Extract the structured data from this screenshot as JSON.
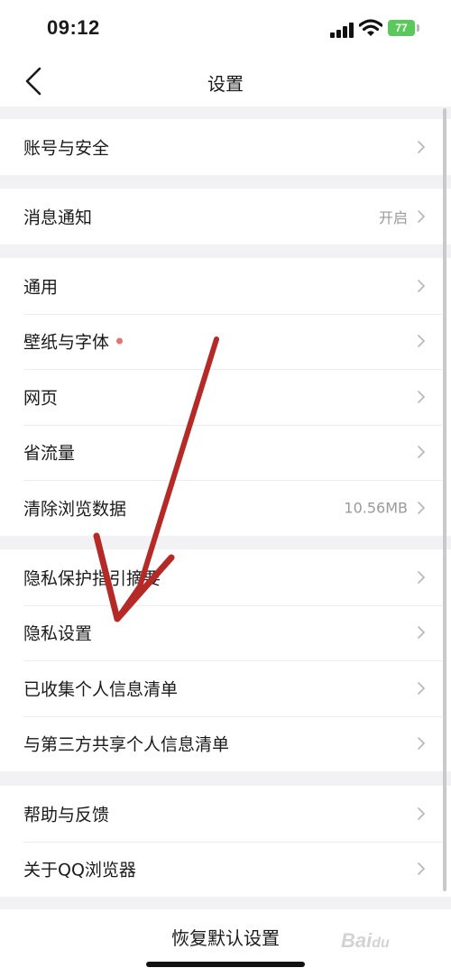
{
  "status_bar": {
    "time": "09:12",
    "battery": "77"
  },
  "header": {
    "title": "设置"
  },
  "groups": [
    {
      "items": [
        {
          "label": "账号与安全",
          "value": ""
        }
      ]
    },
    {
      "items": [
        {
          "label": "消息通知",
          "value": "开启"
        }
      ]
    },
    {
      "items": [
        {
          "label": "通用",
          "value": ""
        },
        {
          "label": "壁纸与字体",
          "value": "",
          "badge": true
        },
        {
          "label": "网页",
          "value": ""
        },
        {
          "label": "省流量",
          "value": ""
        },
        {
          "label": "清除浏览数据",
          "value": "10.56MB"
        }
      ]
    },
    {
      "items": [
        {
          "label": "隐私保护指引摘要",
          "value": ""
        },
        {
          "label": "隐私设置",
          "value": ""
        },
        {
          "label": "已收集个人信息清单",
          "value": ""
        },
        {
          "label": "与第三方共享个人信息清单",
          "value": ""
        }
      ]
    },
    {
      "items": [
        {
          "label": "帮助与反馈",
          "value": ""
        },
        {
          "label": "关于QQ浏览器",
          "value": ""
        }
      ]
    }
  ],
  "footer": {
    "reset_label": "恢复默认设置"
  },
  "watermark": {
    "text": "Baidu经验"
  },
  "colors": {
    "annotation_arrow": "#b52a26",
    "battery": "#5ac85a",
    "badge_dot": "#e57373"
  }
}
